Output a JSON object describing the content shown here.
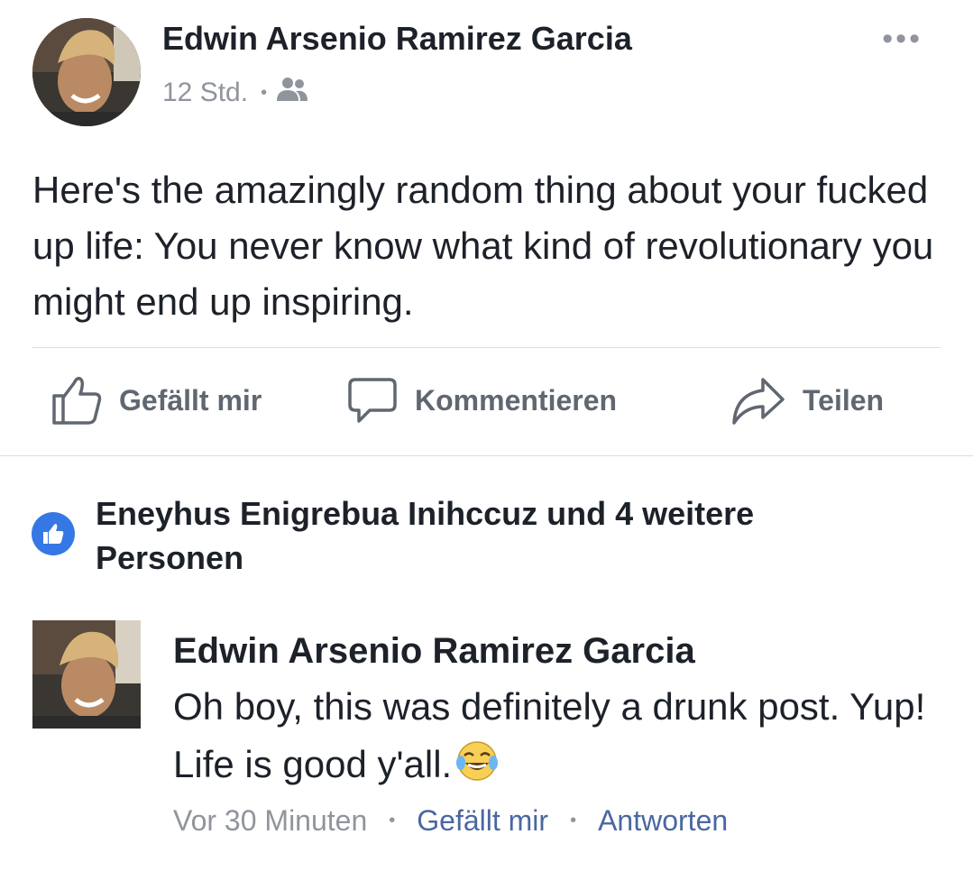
{
  "post": {
    "author": "Edwin Arsenio Ramirez Garcia",
    "time": "12 Std.",
    "audience_icon": "friends-icon",
    "more_label": "•••",
    "text": "Here's the amazingly random thing about your fucked up  life: You never know what kind of revolutionary you might end up inspiring."
  },
  "actions": {
    "like": "Gefällt mir",
    "comment": "Kommentieren",
    "share": "Teilen"
  },
  "reactions": {
    "text": "Eneyhus Enigrebua Inihccuz und 4 weitere Personen",
    "icon": "like-badge-icon",
    "color": "#3578e5"
  },
  "comment": {
    "author": "Edwin Arsenio Ramirez Garcia",
    "text": "Oh boy, this was definitely a drunk post. Yup! Life is good y'all.",
    "emoji": "tears-of-joy-emoji",
    "time": "Vor 30 Minuten",
    "sep": "•",
    "like_label": "Gefällt mir",
    "reply_label": "Antworten"
  },
  "colors": {
    "text": "#1d2129",
    "secondary": "#90949c",
    "link": "#4b67a1",
    "action": "#606770"
  }
}
